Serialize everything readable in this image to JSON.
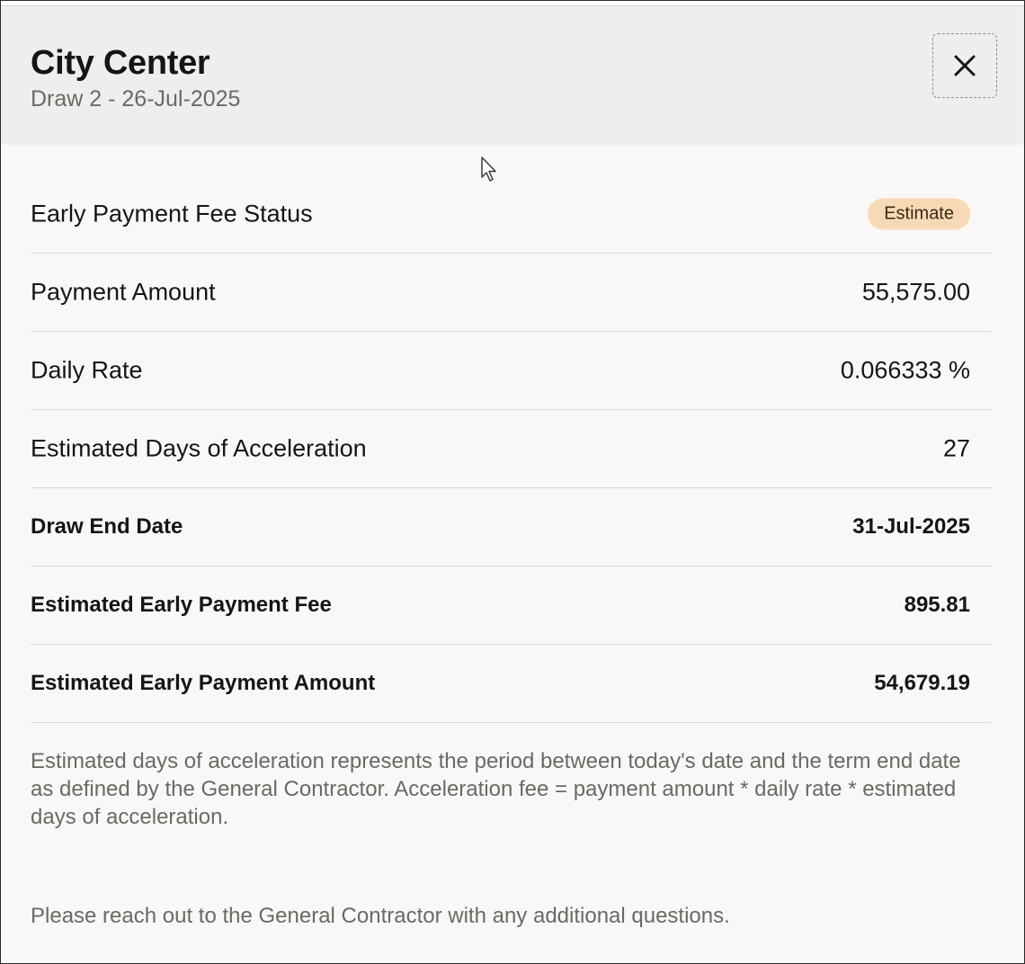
{
  "header": {
    "title": "City Center",
    "subtitle": "Draw 2 - 26-Jul-2025"
  },
  "status": {
    "label": "Early Payment Fee Status",
    "badge": "Estimate",
    "badge_color": "#f7d9b5"
  },
  "rows": [
    {
      "label": "Payment Amount",
      "value": "55,575.00"
    },
    {
      "label": "Daily Rate",
      "value": "0.066333 %"
    },
    {
      "label": "Estimated Days of Acceleration",
      "value": "27"
    },
    {
      "label": "Draw End Date",
      "value": "31-Jul-2025"
    },
    {
      "label": "Estimated Early Payment Fee",
      "value": "895.81"
    },
    {
      "label": "Estimated Early Payment Amount",
      "value": "54,679.19"
    }
  ],
  "notes": {
    "explanation": "Estimated days of acceleration represents the period between today's date and the term end date as defined by the General Contractor. Acceleration fee = payment amount * daily rate * estimated days of acceleration.",
    "contact": "Please reach out to the General Contractor with any additional questions."
  },
  "icons": {
    "close": "close-icon",
    "cursor": "mouse-pointer-icon"
  }
}
